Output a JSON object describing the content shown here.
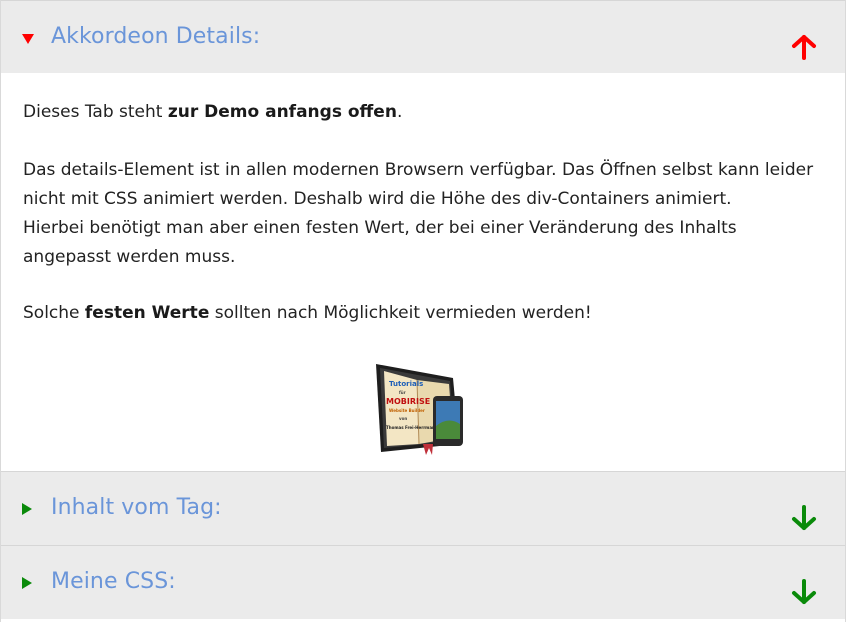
{
  "accordion": {
    "items": [
      {
        "title": "Akkordeon Details:",
        "state": "open",
        "marker_color": "#ff0000",
        "arrow": "arrow-up",
        "arrow_color": "#ff0000"
      },
      {
        "title": "Inhalt vom Tag:",
        "state": "closed",
        "marker_color": "#0a8a0a",
        "arrow": "arrow-down",
        "arrow_color": "#0a8a0a"
      },
      {
        "title": "Meine CSS:",
        "state": "closed",
        "marker_color": "#0a8a0a",
        "arrow": "arrow-down",
        "arrow_color": "#0a8a0a"
      }
    ],
    "open_content": {
      "p1": {
        "pre": "Dieses Tab steht ",
        "bold": "zur Demo anfangs offen",
        "post": "."
      },
      "p2": {
        "line1": "Das details-Element ist in allen modernen Browsern verfügbar. Das Öffnen selbst kann leider nicht mit CSS animiert werden. Deshalb wird die Höhe des div-Containers animiert.",
        "line2": "Hierbei benötigt man aber einen festen Wert, der bei einer Veränderung des Inhalts angepasst werden muss."
      },
      "p3": {
        "pre": "Solche ",
        "bold": "festen Werte",
        "post": " sollten nach Möglichkeit vermieden werden!"
      },
      "image": {
        "alt": "Tutorials für Mobirise",
        "lines": [
          "Tutorials",
          "für",
          "MOBIRISE",
          "Website Builder",
          "von",
          "Thomas Frei-Herrmann"
        ]
      }
    }
  },
  "colors": {
    "title": "#6a95d9",
    "header_bg": "#ebebeb",
    "open_accent": "#ff0000",
    "closed_accent": "#0a8a0a"
  }
}
